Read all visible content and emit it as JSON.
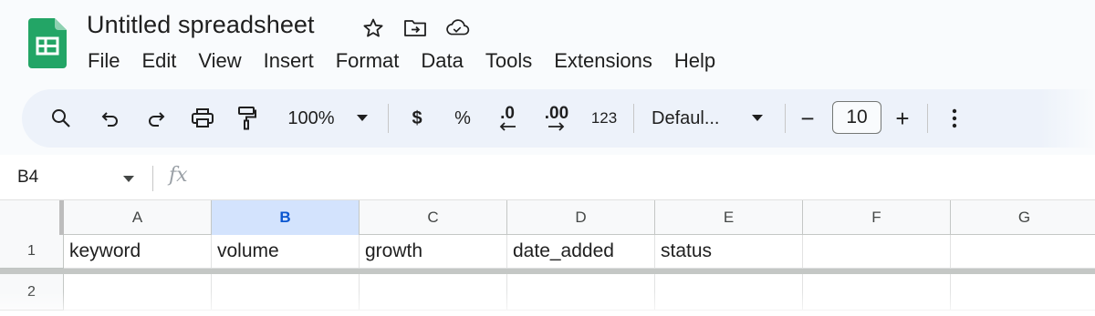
{
  "app": {
    "title": "Untitled spreadsheet"
  },
  "title_icons": [
    "star-icon",
    "move-to-folder-icon",
    "cloud-saved-icon"
  ],
  "menu": [
    "File",
    "Edit",
    "View",
    "Insert",
    "Format",
    "Data",
    "Tools",
    "Extensions",
    "Help"
  ],
  "toolbar": {
    "zoom": "100%",
    "currency": "$",
    "percent": "%",
    "decrease_decimal": ".0",
    "increase_decimal": ".00",
    "more_formats": "123",
    "font": "Defaul...",
    "font_size": "10",
    "minus": "−",
    "plus": "+"
  },
  "formula_bar": {
    "cell_ref": "B4",
    "fx": "fx",
    "value": ""
  },
  "grid": {
    "columns": [
      "A",
      "B",
      "C",
      "D",
      "E",
      "F",
      "G"
    ],
    "selected_column": "B",
    "rows": [
      {
        "num": "1",
        "cells": [
          "keyword",
          "volume",
          "growth",
          "date_added",
          "status",
          "",
          ""
        ]
      },
      {
        "num": "2",
        "cells": [
          "",
          "",
          "",
          "",
          "",
          "",
          ""
        ]
      }
    ]
  },
  "colors": {
    "sheets_green": "#0f9d58",
    "toolbar_bg": "#edf2fa",
    "selected_header_bg": "#d3e3fd",
    "selected_header_text": "#0b57d0"
  }
}
